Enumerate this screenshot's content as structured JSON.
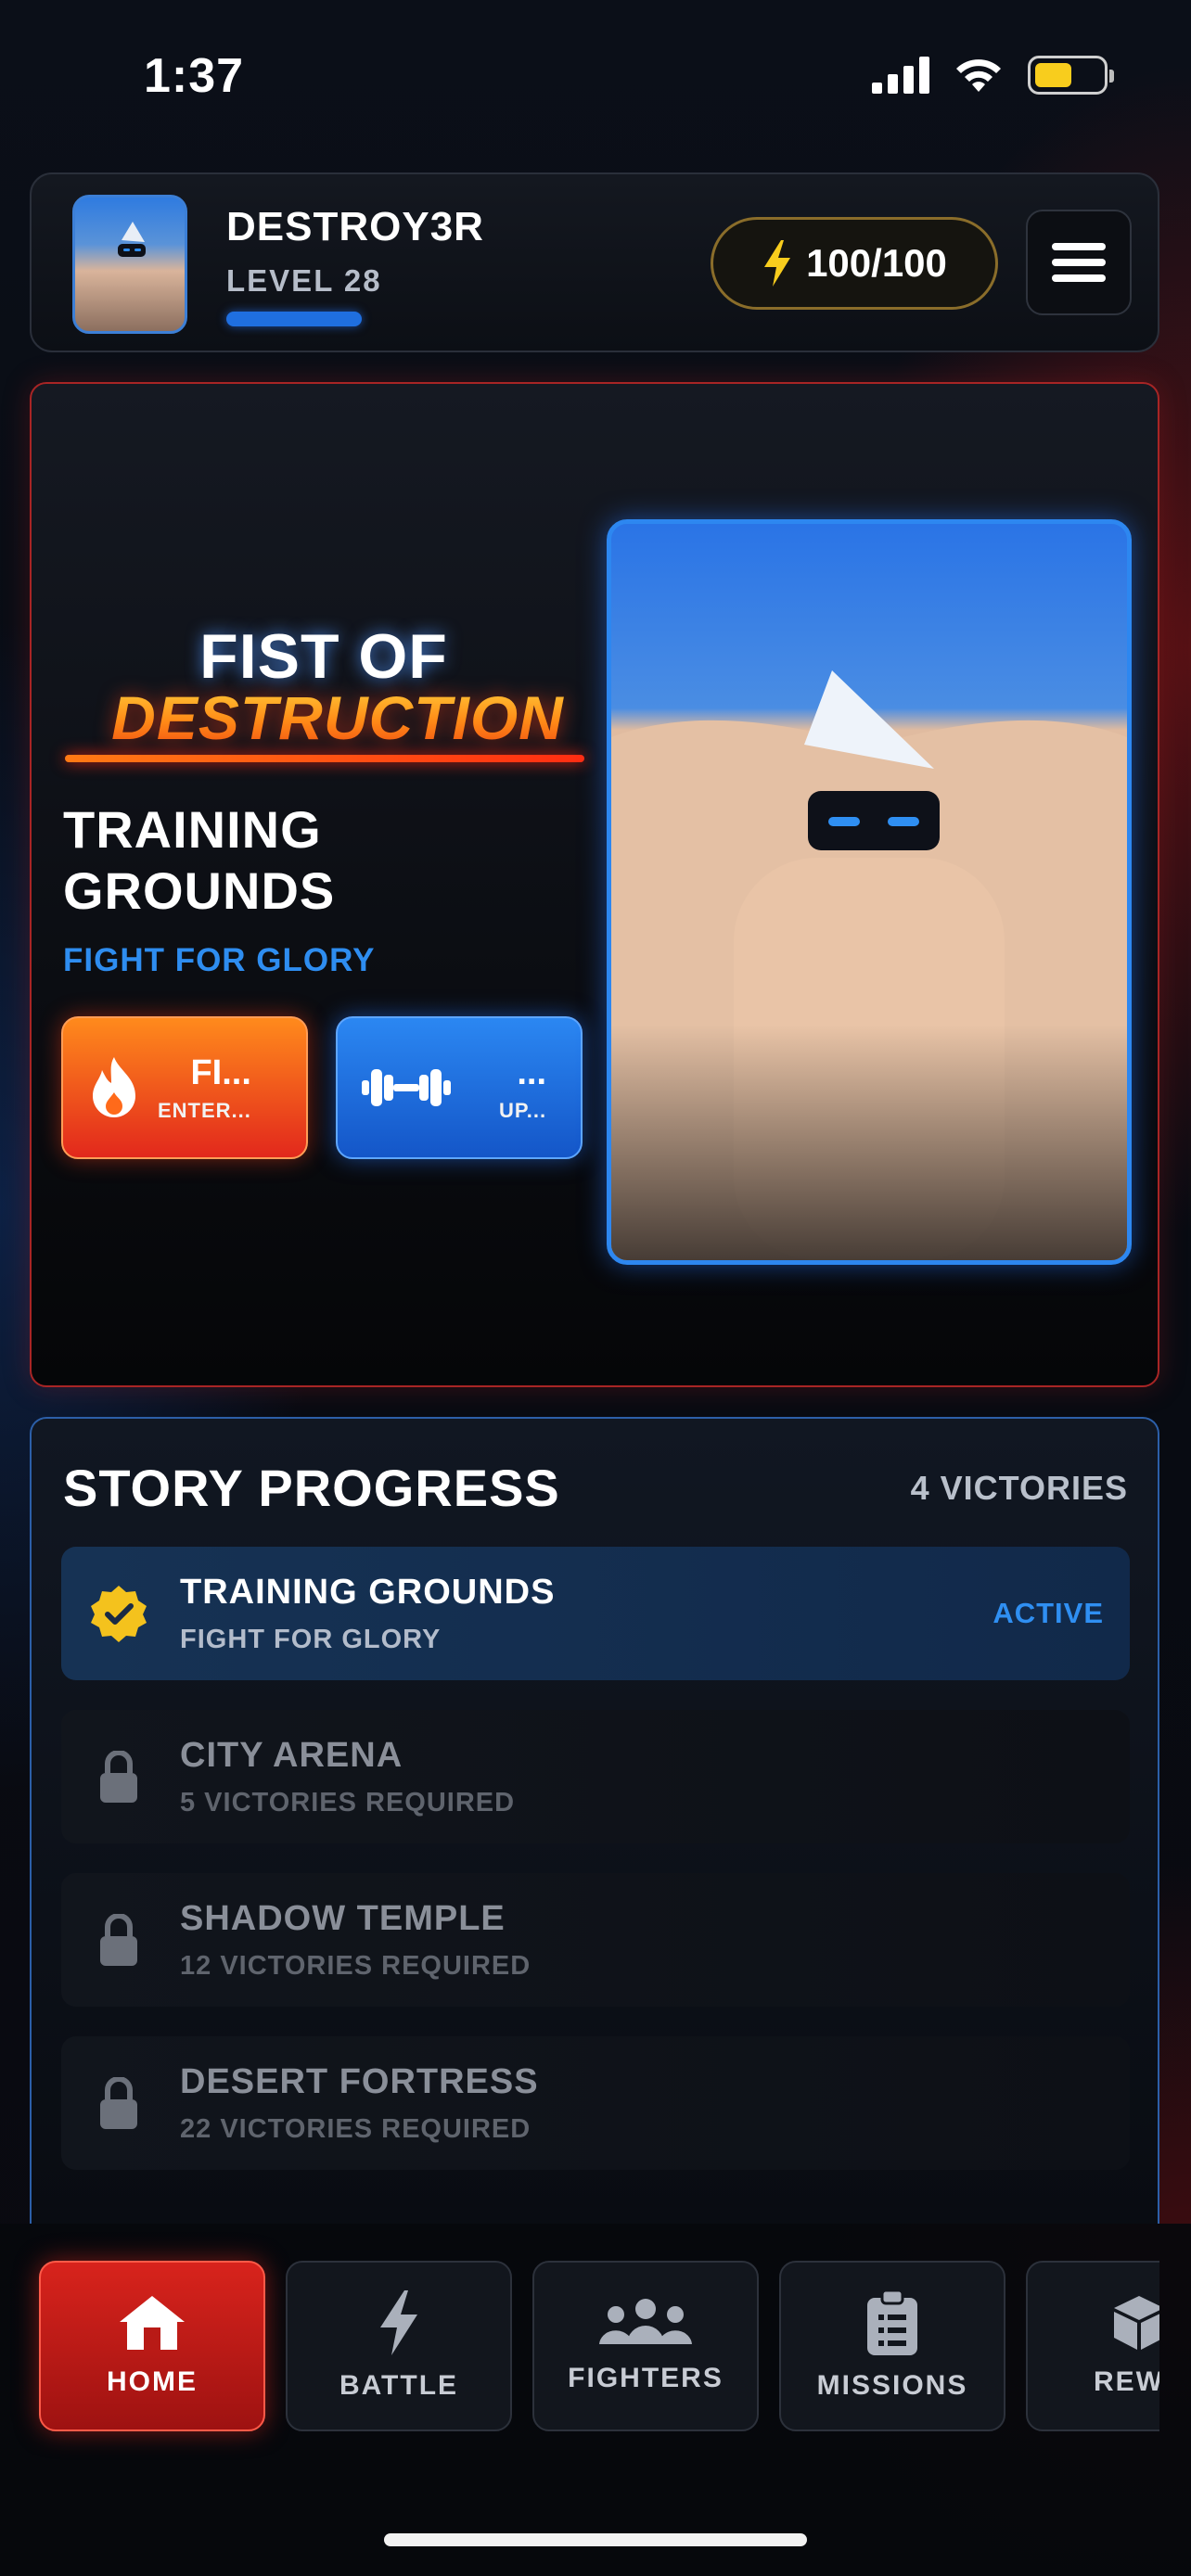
{
  "status_bar": {
    "time": "1:37",
    "battery_level": 0.55
  },
  "player": {
    "name": "DESTROY3R",
    "level": "LEVEL 28",
    "xp_progress": 0.45
  },
  "energy": {
    "label": "100/100"
  },
  "hero": {
    "title_line1": "FIST OF",
    "title_line2": "DESTRUCTION",
    "subtitle": "TRAINING GROUNDS",
    "tagline": "FIGHT FOR GLORY",
    "fight_button": {
      "main": "FI...",
      "sub": "ENTER..."
    },
    "upgrade_button": {
      "main": "...",
      "sub": "UP..."
    }
  },
  "story": {
    "title": "STORY PROGRESS",
    "victories": "4 VICTORIES",
    "stages": [
      {
        "name": "TRAINING GROUNDS",
        "detail": "FIGHT FOR GLORY",
        "badge": "ACTIVE",
        "status": "active"
      },
      {
        "name": "CITY ARENA",
        "detail": "5 VICTORIES REQUIRED",
        "status": "locked"
      },
      {
        "name": "SHADOW TEMPLE",
        "detail": "12 VICTORIES REQUIRED",
        "status": "locked"
      },
      {
        "name": "DESERT FORTRESS",
        "detail": "22 VICTORIES REQUIRED",
        "status": "locked"
      }
    ]
  },
  "nav": {
    "items": [
      {
        "label": "HOME",
        "icon": "home-icon",
        "active": true
      },
      {
        "label": "BATTLE",
        "icon": "lightning-icon"
      },
      {
        "label": "FIGHTERS",
        "icon": "users-icon"
      },
      {
        "label": "MISSIONS",
        "icon": "clipboard-icon"
      },
      {
        "label": "REWA",
        "icon": "box-icon"
      }
    ]
  },
  "colors": {
    "accent_red": "#d8231c",
    "accent_blue": "#2f8ff2",
    "accent_gold": "#f8cd1d"
  }
}
